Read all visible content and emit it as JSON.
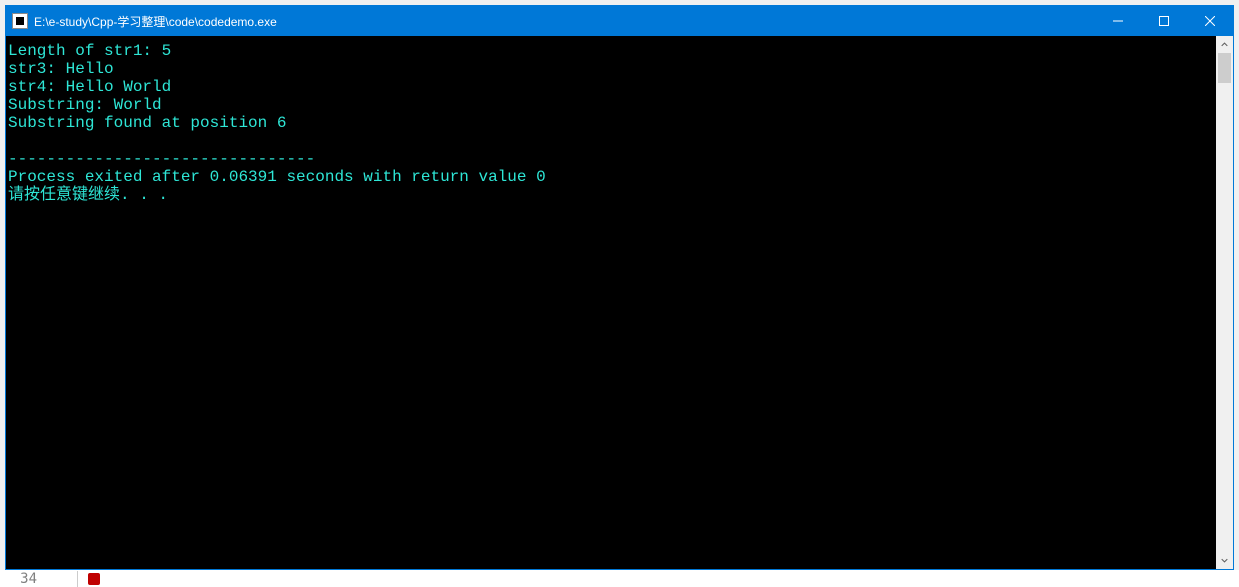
{
  "window": {
    "title": "E:\\e-study\\Cpp-学习整理\\code\\codedemo.exe"
  },
  "console": {
    "lines": [
      "Length of str1: 5",
      "str3: Hello",
      "str4: Hello World",
      "Substring: World",
      "Substring found at position 6",
      "",
      "--------------------------------",
      "Process exited after 0.06391 seconds with return value 0",
      "请按任意键继续. . ."
    ]
  },
  "behind": {
    "line_number": "34"
  }
}
